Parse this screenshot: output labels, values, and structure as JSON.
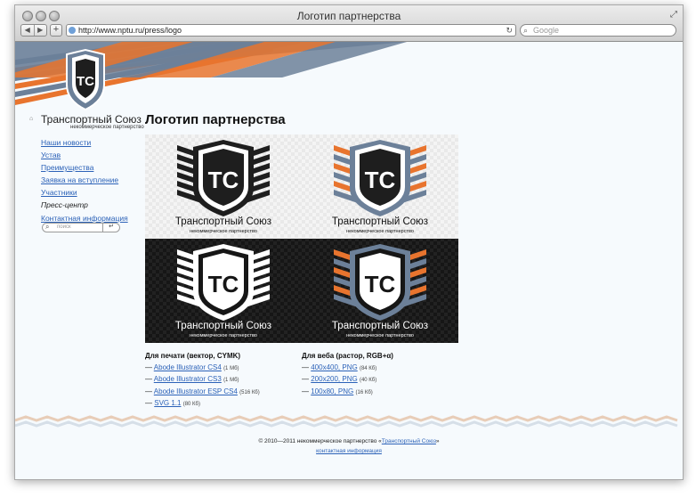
{
  "browser": {
    "window_title": "Логотип партнерства",
    "url": "http://www.nptu.ru/press/logo",
    "search_placeholder": "Google",
    "back_glyph": "◀",
    "forward_glyph": "▶",
    "add_glyph": "+",
    "reload_glyph": "↻",
    "resize_glyph": "⤢",
    "search_glyph": "⌕"
  },
  "site": {
    "name": "Транспортный Союз",
    "subtitle": "некоммерческое партнерство",
    "emblem_letters": "TC",
    "accent_orange": "#e8742e",
    "accent_blue": "#6c8099",
    "home_glyph": "⌂"
  },
  "nav": {
    "items": [
      {
        "label": "Наши новости"
      },
      {
        "label": "Устав"
      },
      {
        "label": "Преимущества"
      },
      {
        "label": "Заявка на вступление"
      },
      {
        "label": "Участники"
      },
      {
        "label": "Пресс-центр"
      },
      {
        "label": "Контактная информация"
      }
    ],
    "current_index": 5,
    "search_placeholder": "поиск",
    "search_glyph": "⌕",
    "go_glyph": "↵"
  },
  "main": {
    "title": "Логотип партнерства",
    "logos": [
      {
        "name": "Транспортный Союз",
        "subtitle": "некоммерческое партнерство",
        "letters": "TC",
        "variant": "black-on-white"
      },
      {
        "name": "Транспортный Союз",
        "subtitle": "некоммерческое партнерство",
        "letters": "TC",
        "variant": "color-on-white"
      },
      {
        "name": "Транспортный Союз",
        "subtitle": "некоммерческое партнерство",
        "letters": "TC",
        "variant": "white-on-black"
      },
      {
        "name": "Транспортный Союз",
        "subtitle": "некоммерческое партнерство",
        "letters": "TC",
        "variant": "color-on-black"
      }
    ],
    "print": {
      "heading": "Для печати (вектор, CYMK)",
      "files": [
        {
          "dash": "— ",
          "label": "Abode Illustrator CS4",
          "size": "(1 Мб)"
        },
        {
          "dash": "— ",
          "label": "Abode Illustrator CS3",
          "size": "(1 Мб)"
        },
        {
          "dash": "— ",
          "label": "Abode Illustrator ESP CS4",
          "size": "(516 Кб)"
        },
        {
          "dash": "— ",
          "label": "SVG 1.1",
          "size": "(80 Кб)"
        }
      ]
    },
    "web": {
      "heading": "Для веба (растор, RGB+α)",
      "files": [
        {
          "dash": "— ",
          "label": "400x400, PNG",
          "size": "(84 Кб)"
        },
        {
          "dash": "— ",
          "label": "200x200, PNG",
          "size": "(40 Кб)"
        },
        {
          "dash": "— ",
          "label": "100x80, PNG",
          "size": "(16 Кб)"
        }
      ]
    }
  },
  "footer": {
    "copyright_prefix": "© 2010—2011 некоммерческое партнерство «",
    "link": "Транспортный Союз",
    "copyright_suffix": "»",
    "contact_link": "контактная информация"
  }
}
